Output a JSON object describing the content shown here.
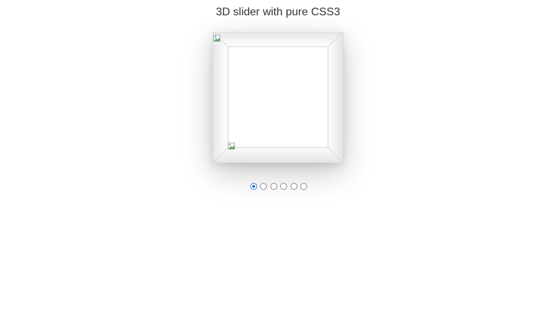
{
  "page": {
    "title": "3D slider with pure CSS3"
  },
  "slider": {
    "slide_count": 6,
    "active_index": 0,
    "slides": [
      {
        "label": "slide-1"
      },
      {
        "label": "slide-2"
      },
      {
        "label": "slide-3"
      },
      {
        "label": "slide-4"
      },
      {
        "label": "slide-5"
      },
      {
        "label": "slide-6"
      }
    ]
  },
  "colors": {
    "title_text": "#333333",
    "frame_light": "#ffffff",
    "frame_edge": "#cfcfcf",
    "active_dot": "#1f6fd1",
    "inactive_dot_border": "#8a8a8a"
  },
  "icons": {
    "broken_image": "broken-image-icon"
  }
}
